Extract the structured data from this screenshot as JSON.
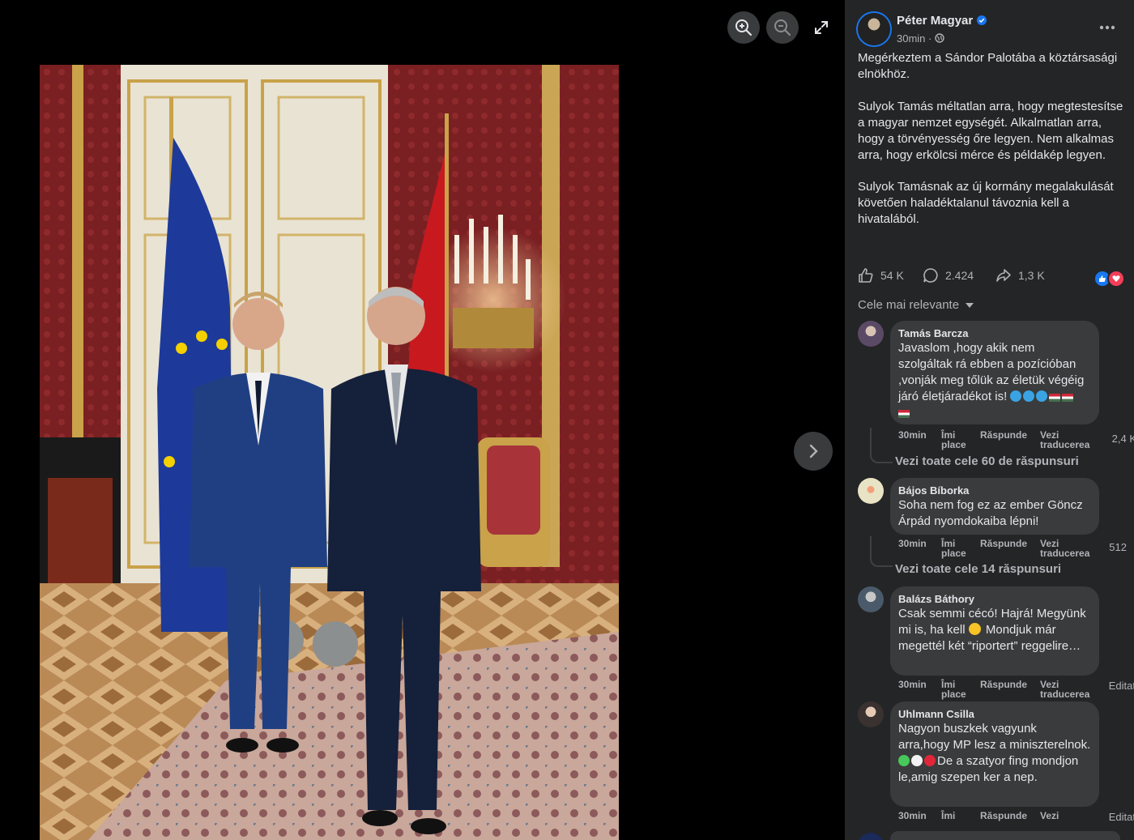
{
  "viewer": {
    "zoom_in": "zoom-in-icon",
    "zoom_out": "zoom-out-icon",
    "fullscreen": "expand-icon",
    "next": "chevron-right-icon"
  },
  "post": {
    "author": "Péter Magyar",
    "time": "30min · ",
    "paragraphs": [
      "Megérkeztem a Sándor Palotába a köztársasági elnökhöz.",
      "Sulyok Tamás méltatlan arra, hogy megtestesítse a magyar nemzet egységét. Alkalmatlan arra, hogy a törvényesség őre legyen. Nem alkalmas arra, hogy erkölcsi mérce és példakép legyen.",
      "Sulyok Tamásnak az új kormány megalakulását követően haladéktalanul távoznia kell a hivatalából."
    ],
    "likes": "54 K",
    "comments": "2.424",
    "shares": "1,3 K"
  },
  "sort_label": "Cele mai relevante",
  "comments": [
    {
      "name": "Tamás Barcza",
      "text": "Javaslom ,hogy akik nem szolgáltak rá ebben a pozícióban ,vonják meg tőlük az életük végéig járó életjáradékot is!",
      "time": "30min",
      "like": "Îmi place",
      "reply": "Răspunde",
      "translate": "Vezi traducerea",
      "count": "2,4 K",
      "replies": "Vezi toate cele 60 de răspunsuri"
    },
    {
      "name": "Bájos Bíborka",
      "text": "Soha nem fog ez az ember Göncz Árpád nyomdokaiba lépni!",
      "time": "30min",
      "like": "Îmi place",
      "reply": "Răspunde",
      "translate": "Vezi traducerea",
      "count": "512",
      "replies": "Vezi toate cele 14 răspunsuri"
    },
    {
      "name": "Balázs Báthory",
      "text1": "Csak semmi cécó! Hajrá! Megyünk mi is, ha kell",
      "text2": " Mondjuk már megettél két “riportert” reggelire…",
      "time": "30min",
      "like": "Îmi place",
      "reply": "Răspunde",
      "translate": "Vezi traducerea",
      "count": "Editat"
    },
    {
      "name": "Uhlmann Csilla",
      "text1": "Nagyon buszkek vagyunk arra,hogy MP lesz a miniszterelnok.",
      "text2": "De a szatyor fing mondjon le,amig szepen ker a nep.",
      "time": "30min",
      "like": "Îmi",
      "reply": "Răspunde",
      "translate": "Vezi",
      "count": "Editat"
    }
  ],
  "colors": {
    "panel": "#242526",
    "bubble": "#3a3b3c",
    "accent": "#1877f2"
  }
}
